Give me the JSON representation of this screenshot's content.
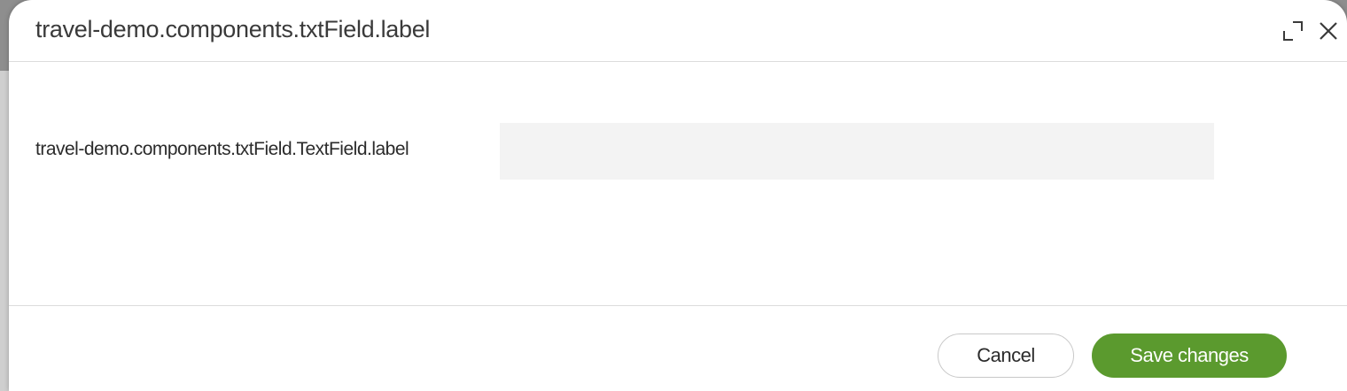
{
  "dialog": {
    "title": "travel-demo.components.txtField.label",
    "expand_icon": "expand-icon",
    "close_icon": "close-icon"
  },
  "form": {
    "field_label": "travel-demo.components.txtField.TextField.label",
    "field_value": "",
    "field_placeholder": ""
  },
  "footer": {
    "cancel_label": "Cancel",
    "save_label": "Save changes"
  },
  "colors": {
    "primary": "#5b9a2e",
    "input_background": "#f3f3f3",
    "divider": "#dcdcdc"
  }
}
